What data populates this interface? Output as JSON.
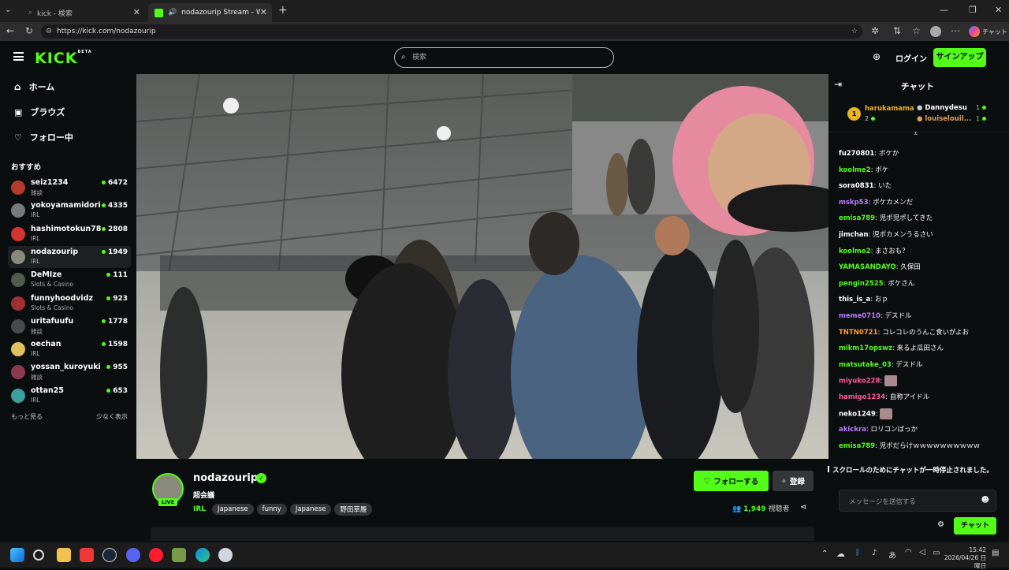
{
  "browser": {
    "tabs": [
      {
        "title": "kick - 検索",
        "active": false
      },
      {
        "title": "nodazourip Stream - Watch L",
        "active": true
      }
    ],
    "url": "https://kick.com/nodazourip"
  },
  "header": {
    "logo": "KICK",
    "logo_badge": "BETA",
    "search_placeholder": "検索",
    "login_label": "ログイン",
    "signup_label": "サインアップ"
  },
  "sidebar": {
    "nav": [
      {
        "label": "ホーム",
        "icon": "home-icon"
      },
      {
        "label": "ブラウズ",
        "icon": "browse-icon"
      },
      {
        "label": "フォロー中",
        "icon": "heart-icon"
      }
    ],
    "recommended_title": "おすすめ",
    "recommended": [
      {
        "name": "seiz1234",
        "category": "雑談",
        "viewers": "6472",
        "color": "#b33b2e"
      },
      {
        "name": "yokoyamamidori",
        "category": "IRL",
        "viewers": "4335",
        "color": "#777a7c"
      },
      {
        "name": "hashimotokun78",
        "category": "IRL",
        "viewers": "2808",
        "color": "#d83333"
      },
      {
        "name": "nodazourip",
        "category": "IRL",
        "viewers": "1949",
        "color": "#8a8a7a",
        "selected": true
      },
      {
        "name": "DeMIze",
        "category": "Slots & Casino",
        "viewers": "111",
        "color": "#505a50"
      },
      {
        "name": "funnyhoodvidz",
        "category": "Slots & Casino",
        "viewers": "923",
        "color": "#a03030"
      },
      {
        "name": "uritafuufu",
        "category": "雑談",
        "viewers": "1778",
        "color": "#4a4a4a"
      },
      {
        "name": "oechan",
        "category": "IRL",
        "viewers": "1598",
        "color": "#e0c060"
      },
      {
        "name": "yossan_kuroyuki",
        "category": "雑談",
        "viewers": "955",
        "color": "#8c3a50"
      },
      {
        "name": "ottan25",
        "category": "IRL",
        "viewers": "653",
        "color": "#3aa0a0"
      }
    ],
    "show_more": "もっと見る",
    "show_less": "少なく表示"
  },
  "stream": {
    "channel": "nodazourip",
    "title": "超会議",
    "live_badge": "LIVE",
    "category": "IRL",
    "tags": [
      "Japanese",
      "funny",
      "Japanese",
      "野田草履"
    ],
    "follow_label": "フォローする",
    "subscribe_label": "登録",
    "viewer_count": "1,949",
    "viewer_label": "視聴者"
  },
  "chat": {
    "title": "チャット",
    "gifters": [
      {
        "rank": "1",
        "name": "harukamama",
        "count": "2"
      },
      {
        "name": "Dannydesu",
        "count": "1"
      },
      {
        "name": "louiselouil...",
        "count": "1"
      }
    ],
    "messages": [
      {
        "user": "fu270801",
        "text": "ボケか",
        "color": "#ffffff"
      },
      {
        "user": "koolme2",
        "text": "ボケ",
        "color": "#53fc18"
      },
      {
        "user": "sora0831",
        "text": "いた",
        "color": "#ffffff"
      },
      {
        "user": "mskp53",
        "text": "ボケカメンだ",
        "color": "#b97bff"
      },
      {
        "user": "emisa789",
        "text": "児ポ児ポしてきた",
        "color": "#53fc18"
      },
      {
        "user": "jimchan",
        "text": "児ポカメンうるさい",
        "color": "#ffffff"
      },
      {
        "user": "koolme2",
        "text": "まさおも？",
        "color": "#53fc18"
      },
      {
        "user": "YAMASANDAYO",
        "text": "久保田",
        "color": "#53fc18"
      },
      {
        "user": "pengin2525",
        "text": "ボケさん",
        "color": "#53fc18"
      },
      {
        "user": "this_is_a",
        "text": "おｐ",
        "color": "#ffffff"
      },
      {
        "user": "meme0710",
        "text": "デスドル",
        "color": "#b97bff"
      },
      {
        "user": "TNTN0721",
        "text": "コレコレのうんこ食いがよお",
        "color": "#ff9a3c"
      },
      {
        "user": "mikm17opswz",
        "text": "来るよ瓜田さん",
        "color": "#53fc18"
      },
      {
        "user": "matsutake_03",
        "text": "デスドル",
        "color": "#53fc18"
      },
      {
        "user": "miyuko228",
        "text": "",
        "color": "#ff5aa0"
      },
      {
        "user": "hamigo1234",
        "text": "自称アイドル",
        "color": "#ff5aa0"
      },
      {
        "user": "neko1249",
        "text": "",
        "color": "#ffffff"
      },
      {
        "user": "akickra",
        "text": "ロリコンばっか",
        "color": "#b97bff"
      },
      {
        "user": "emisa789",
        "text": "児ポだらけｗｗｗｗｗｗｗｗｗｗ",
        "color": "#53fc18"
      }
    ],
    "paused_notice": "スクロールのためにチャットが一時停止されました。",
    "input_placeholder": "メッセージを送信する",
    "send_label": "チャット"
  },
  "taskbar": {
    "time": "15:42",
    "date": "2026/04/26 日曜日",
    "ime": "あ"
  }
}
